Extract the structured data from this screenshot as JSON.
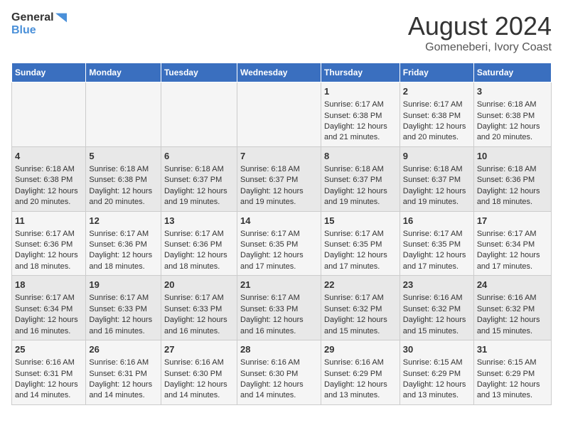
{
  "header": {
    "logo_general": "General",
    "logo_blue": "Blue",
    "main_title": "August 2024",
    "subtitle": "Gomeneberi, Ivory Coast"
  },
  "calendar": {
    "days_of_week": [
      "Sunday",
      "Monday",
      "Tuesday",
      "Wednesday",
      "Thursday",
      "Friday",
      "Saturday"
    ],
    "weeks": [
      [
        {
          "day": "",
          "info": ""
        },
        {
          "day": "",
          "info": ""
        },
        {
          "day": "",
          "info": ""
        },
        {
          "day": "",
          "info": ""
        },
        {
          "day": "1",
          "info": "Sunrise: 6:17 AM\nSunset: 6:38 PM\nDaylight: 12 hours and 21 minutes."
        },
        {
          "day": "2",
          "info": "Sunrise: 6:17 AM\nSunset: 6:38 PM\nDaylight: 12 hours and 20 minutes."
        },
        {
          "day": "3",
          "info": "Sunrise: 6:18 AM\nSunset: 6:38 PM\nDaylight: 12 hours and 20 minutes."
        }
      ],
      [
        {
          "day": "4",
          "info": "Sunrise: 6:18 AM\nSunset: 6:38 PM\nDaylight: 12 hours and 20 minutes."
        },
        {
          "day": "5",
          "info": "Sunrise: 6:18 AM\nSunset: 6:38 PM\nDaylight: 12 hours and 20 minutes."
        },
        {
          "day": "6",
          "info": "Sunrise: 6:18 AM\nSunset: 6:37 PM\nDaylight: 12 hours and 19 minutes."
        },
        {
          "day": "7",
          "info": "Sunrise: 6:18 AM\nSunset: 6:37 PM\nDaylight: 12 hours and 19 minutes."
        },
        {
          "day": "8",
          "info": "Sunrise: 6:18 AM\nSunset: 6:37 PM\nDaylight: 12 hours and 19 minutes."
        },
        {
          "day": "9",
          "info": "Sunrise: 6:18 AM\nSunset: 6:37 PM\nDaylight: 12 hours and 19 minutes."
        },
        {
          "day": "10",
          "info": "Sunrise: 6:18 AM\nSunset: 6:36 PM\nDaylight: 12 hours and 18 minutes."
        }
      ],
      [
        {
          "day": "11",
          "info": "Sunrise: 6:17 AM\nSunset: 6:36 PM\nDaylight: 12 hours and 18 minutes."
        },
        {
          "day": "12",
          "info": "Sunrise: 6:17 AM\nSunset: 6:36 PM\nDaylight: 12 hours and 18 minutes."
        },
        {
          "day": "13",
          "info": "Sunrise: 6:17 AM\nSunset: 6:36 PM\nDaylight: 12 hours and 18 minutes."
        },
        {
          "day": "14",
          "info": "Sunrise: 6:17 AM\nSunset: 6:35 PM\nDaylight: 12 hours and 17 minutes."
        },
        {
          "day": "15",
          "info": "Sunrise: 6:17 AM\nSunset: 6:35 PM\nDaylight: 12 hours and 17 minutes."
        },
        {
          "day": "16",
          "info": "Sunrise: 6:17 AM\nSunset: 6:35 PM\nDaylight: 12 hours and 17 minutes."
        },
        {
          "day": "17",
          "info": "Sunrise: 6:17 AM\nSunset: 6:34 PM\nDaylight: 12 hours and 17 minutes."
        }
      ],
      [
        {
          "day": "18",
          "info": "Sunrise: 6:17 AM\nSunset: 6:34 PM\nDaylight: 12 hours and 16 minutes."
        },
        {
          "day": "19",
          "info": "Sunrise: 6:17 AM\nSunset: 6:33 PM\nDaylight: 12 hours and 16 minutes."
        },
        {
          "day": "20",
          "info": "Sunrise: 6:17 AM\nSunset: 6:33 PM\nDaylight: 12 hours and 16 minutes."
        },
        {
          "day": "21",
          "info": "Sunrise: 6:17 AM\nSunset: 6:33 PM\nDaylight: 12 hours and 16 minutes."
        },
        {
          "day": "22",
          "info": "Sunrise: 6:17 AM\nSunset: 6:32 PM\nDaylight: 12 hours and 15 minutes."
        },
        {
          "day": "23",
          "info": "Sunrise: 6:16 AM\nSunset: 6:32 PM\nDaylight: 12 hours and 15 minutes."
        },
        {
          "day": "24",
          "info": "Sunrise: 6:16 AM\nSunset: 6:32 PM\nDaylight: 12 hours and 15 minutes."
        }
      ],
      [
        {
          "day": "25",
          "info": "Sunrise: 6:16 AM\nSunset: 6:31 PM\nDaylight: 12 hours and 14 minutes."
        },
        {
          "day": "26",
          "info": "Sunrise: 6:16 AM\nSunset: 6:31 PM\nDaylight: 12 hours and 14 minutes."
        },
        {
          "day": "27",
          "info": "Sunrise: 6:16 AM\nSunset: 6:30 PM\nDaylight: 12 hours and 14 minutes."
        },
        {
          "day": "28",
          "info": "Sunrise: 6:16 AM\nSunset: 6:30 PM\nDaylight: 12 hours and 14 minutes."
        },
        {
          "day": "29",
          "info": "Sunrise: 6:16 AM\nSunset: 6:29 PM\nDaylight: 12 hours and 13 minutes."
        },
        {
          "day": "30",
          "info": "Sunrise: 6:15 AM\nSunset: 6:29 PM\nDaylight: 12 hours and 13 minutes."
        },
        {
          "day": "31",
          "info": "Sunrise: 6:15 AM\nSunset: 6:29 PM\nDaylight: 12 hours and 13 minutes."
        }
      ]
    ]
  }
}
